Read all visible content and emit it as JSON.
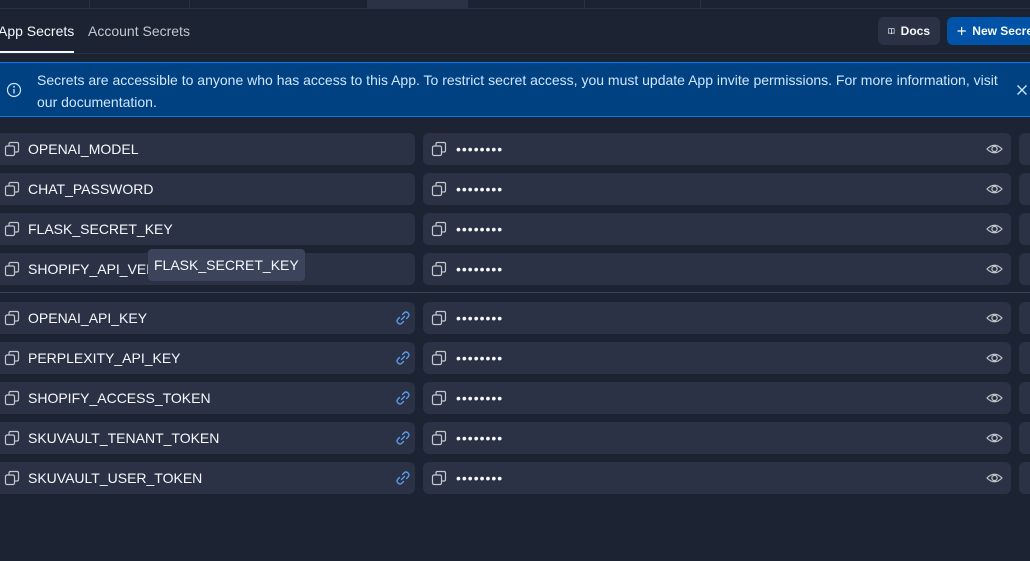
{
  "tabs": [
    {
      "label": "App Secrets"
    },
    {
      "label": "Account Secrets"
    }
  ],
  "toolbar": {
    "docs_label": "Docs",
    "new_secret_label": "New Secret"
  },
  "banner": {
    "text": "Secrets are accessible to anyone who has access to this App. To restrict secret access, you must update App invite permissions. For more information, visit our documentation."
  },
  "secrets": [
    {
      "key": "OPENAI_MODEL",
      "value": "••••••••",
      "linked": false
    },
    {
      "key": "CHAT_PASSWORD",
      "value": "••••••••",
      "linked": false
    },
    {
      "key": "FLASK_SECRET_KEY",
      "value": "••••••••",
      "linked": false
    },
    {
      "key": "SHOPIFY_API_VER",
      "value": "••••••••",
      "linked": false
    },
    {
      "key": "OPENAI_API_KEY",
      "value": "••••••••",
      "linked": true
    },
    {
      "key": "PERPLEXITY_API_KEY",
      "value": "••••••••",
      "linked": true
    },
    {
      "key": "SHOPIFY_ACCESS_TOKEN",
      "value": "••••••••",
      "linked": true
    },
    {
      "key": "SKUVAULT_TENANT_TOKEN",
      "value": "••••••••",
      "linked": true
    },
    {
      "key": "SKUVAULT_USER_TOKEN",
      "value": "••••••••",
      "linked": true
    }
  ],
  "tooltip": {
    "text": "FLASK_SECRET_KEY"
  },
  "colors": {
    "background": "#1c2333",
    "surface": "#2b3245",
    "banner": "#004182",
    "primary_button": "#0053a6",
    "link_icon": "#5a9cf0"
  }
}
